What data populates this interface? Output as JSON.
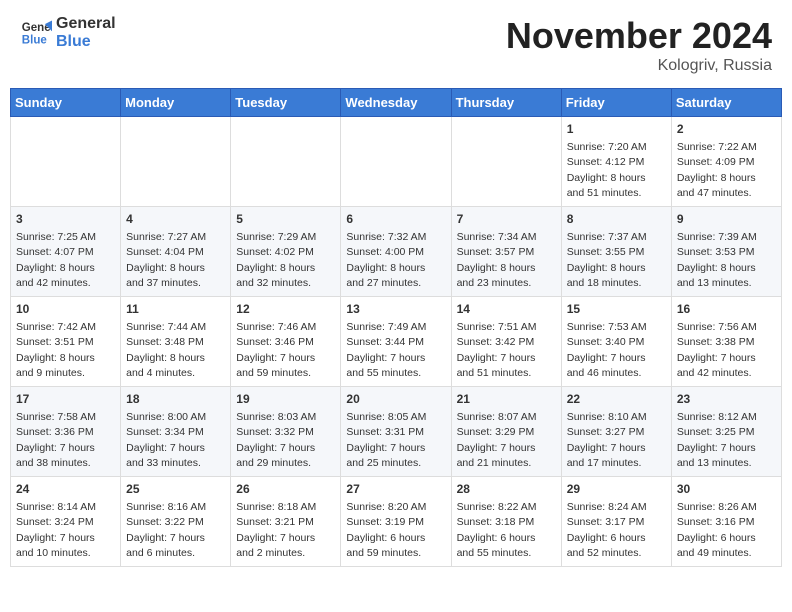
{
  "header": {
    "logo_general": "General",
    "logo_blue": "Blue",
    "month_title": "November 2024",
    "location": "Kologriv, Russia"
  },
  "weekdays": [
    "Sunday",
    "Monday",
    "Tuesday",
    "Wednesday",
    "Thursday",
    "Friday",
    "Saturday"
  ],
  "weeks": [
    [
      {
        "day": "",
        "info": ""
      },
      {
        "day": "",
        "info": ""
      },
      {
        "day": "",
        "info": ""
      },
      {
        "day": "",
        "info": ""
      },
      {
        "day": "",
        "info": ""
      },
      {
        "day": "1",
        "info": "Sunrise: 7:20 AM\nSunset: 4:12 PM\nDaylight: 8 hours\nand 51 minutes."
      },
      {
        "day": "2",
        "info": "Sunrise: 7:22 AM\nSunset: 4:09 PM\nDaylight: 8 hours\nand 47 minutes."
      }
    ],
    [
      {
        "day": "3",
        "info": "Sunrise: 7:25 AM\nSunset: 4:07 PM\nDaylight: 8 hours\nand 42 minutes."
      },
      {
        "day": "4",
        "info": "Sunrise: 7:27 AM\nSunset: 4:04 PM\nDaylight: 8 hours\nand 37 minutes."
      },
      {
        "day": "5",
        "info": "Sunrise: 7:29 AM\nSunset: 4:02 PM\nDaylight: 8 hours\nand 32 minutes."
      },
      {
        "day": "6",
        "info": "Sunrise: 7:32 AM\nSunset: 4:00 PM\nDaylight: 8 hours\nand 27 minutes."
      },
      {
        "day": "7",
        "info": "Sunrise: 7:34 AM\nSunset: 3:57 PM\nDaylight: 8 hours\nand 23 minutes."
      },
      {
        "day": "8",
        "info": "Sunrise: 7:37 AM\nSunset: 3:55 PM\nDaylight: 8 hours\nand 18 minutes."
      },
      {
        "day": "9",
        "info": "Sunrise: 7:39 AM\nSunset: 3:53 PM\nDaylight: 8 hours\nand 13 minutes."
      }
    ],
    [
      {
        "day": "10",
        "info": "Sunrise: 7:42 AM\nSunset: 3:51 PM\nDaylight: 8 hours\nand 9 minutes."
      },
      {
        "day": "11",
        "info": "Sunrise: 7:44 AM\nSunset: 3:48 PM\nDaylight: 8 hours\nand 4 minutes."
      },
      {
        "day": "12",
        "info": "Sunrise: 7:46 AM\nSunset: 3:46 PM\nDaylight: 7 hours\nand 59 minutes."
      },
      {
        "day": "13",
        "info": "Sunrise: 7:49 AM\nSunset: 3:44 PM\nDaylight: 7 hours\nand 55 minutes."
      },
      {
        "day": "14",
        "info": "Sunrise: 7:51 AM\nSunset: 3:42 PM\nDaylight: 7 hours\nand 51 minutes."
      },
      {
        "day": "15",
        "info": "Sunrise: 7:53 AM\nSunset: 3:40 PM\nDaylight: 7 hours\nand 46 minutes."
      },
      {
        "day": "16",
        "info": "Sunrise: 7:56 AM\nSunset: 3:38 PM\nDaylight: 7 hours\nand 42 minutes."
      }
    ],
    [
      {
        "day": "17",
        "info": "Sunrise: 7:58 AM\nSunset: 3:36 PM\nDaylight: 7 hours\nand 38 minutes."
      },
      {
        "day": "18",
        "info": "Sunrise: 8:00 AM\nSunset: 3:34 PM\nDaylight: 7 hours\nand 33 minutes."
      },
      {
        "day": "19",
        "info": "Sunrise: 8:03 AM\nSunset: 3:32 PM\nDaylight: 7 hours\nand 29 minutes."
      },
      {
        "day": "20",
        "info": "Sunrise: 8:05 AM\nSunset: 3:31 PM\nDaylight: 7 hours\nand 25 minutes."
      },
      {
        "day": "21",
        "info": "Sunrise: 8:07 AM\nSunset: 3:29 PM\nDaylight: 7 hours\nand 21 minutes."
      },
      {
        "day": "22",
        "info": "Sunrise: 8:10 AM\nSunset: 3:27 PM\nDaylight: 7 hours\nand 17 minutes."
      },
      {
        "day": "23",
        "info": "Sunrise: 8:12 AM\nSunset: 3:25 PM\nDaylight: 7 hours\nand 13 minutes."
      }
    ],
    [
      {
        "day": "24",
        "info": "Sunrise: 8:14 AM\nSunset: 3:24 PM\nDaylight: 7 hours\nand 10 minutes."
      },
      {
        "day": "25",
        "info": "Sunrise: 8:16 AM\nSunset: 3:22 PM\nDaylight: 7 hours\nand 6 minutes."
      },
      {
        "day": "26",
        "info": "Sunrise: 8:18 AM\nSunset: 3:21 PM\nDaylight: 7 hours\nand 2 minutes."
      },
      {
        "day": "27",
        "info": "Sunrise: 8:20 AM\nSunset: 3:19 PM\nDaylight: 6 hours\nand 59 minutes."
      },
      {
        "day": "28",
        "info": "Sunrise: 8:22 AM\nSunset: 3:18 PM\nDaylight: 6 hours\nand 55 minutes."
      },
      {
        "day": "29",
        "info": "Sunrise: 8:24 AM\nSunset: 3:17 PM\nDaylight: 6 hours\nand 52 minutes."
      },
      {
        "day": "30",
        "info": "Sunrise: 8:26 AM\nSunset: 3:16 PM\nDaylight: 6 hours\nand 49 minutes."
      }
    ]
  ]
}
